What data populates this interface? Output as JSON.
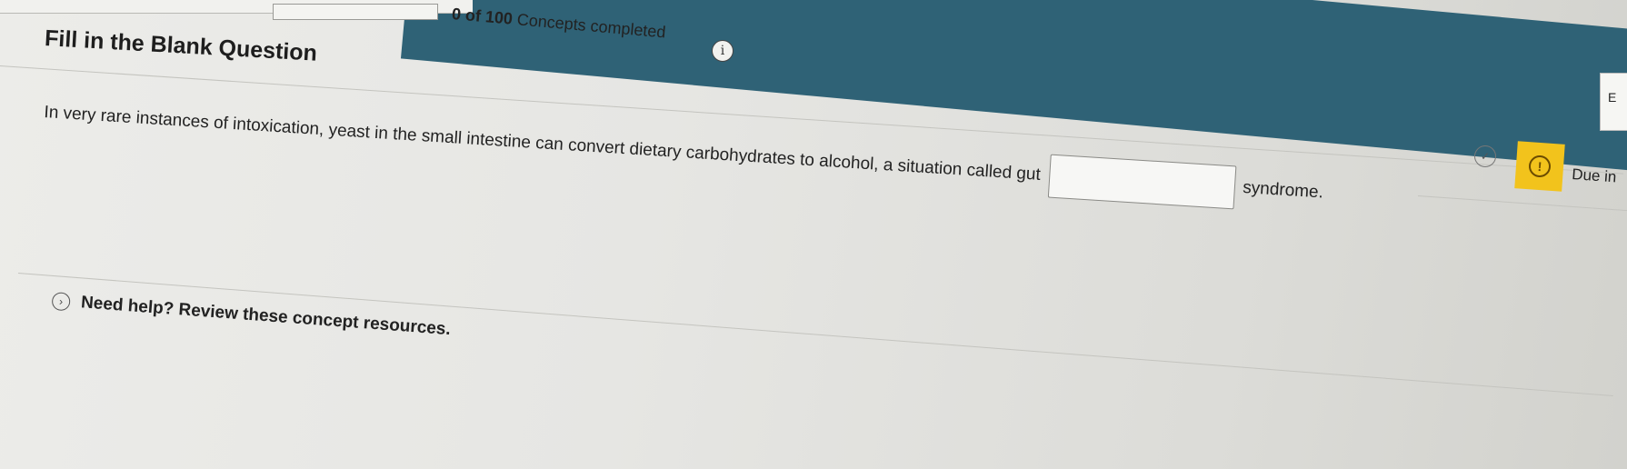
{
  "header": {
    "progress_fraction": 0.0,
    "concepts_count": "0 of 100",
    "concepts_label": "Concepts completed",
    "info_glyph": "i"
  },
  "question": {
    "type_title": "Fill in the Blank Question",
    "prompt_before_blank": "In very rare instances of intoxication, yeast in the small intestine can convert dietary carbohydrates to alcohol, a situation called gut",
    "blank_value": "",
    "prompt_after_blank": "syndrome."
  },
  "help": {
    "label": "Need help? Review these concept resources.",
    "chevron_glyph": "›"
  },
  "status": {
    "check_glyph": "✓",
    "alert_glyph": "!",
    "due_label": "Due in",
    "side_tab_label": "E"
  },
  "colors": {
    "banner": "#2f6276",
    "alert_badge": "#f2c31c"
  }
}
